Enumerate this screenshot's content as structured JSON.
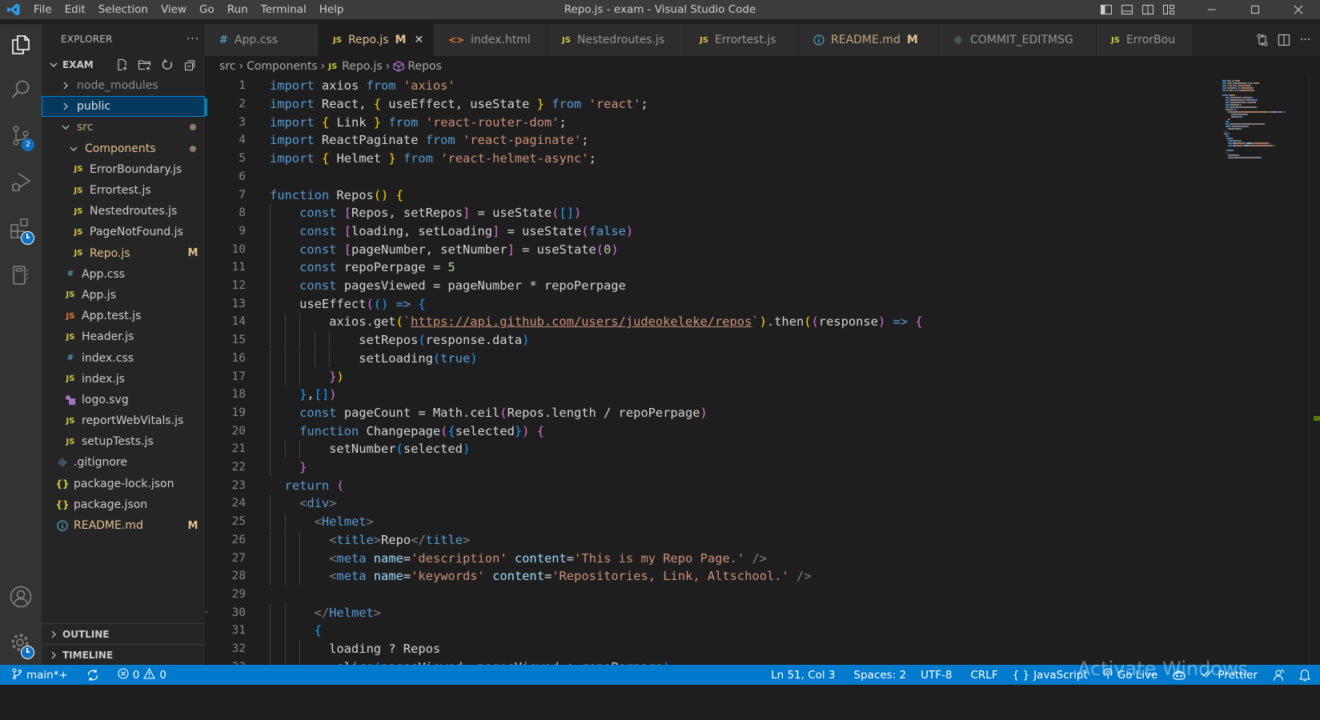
{
  "titlebar": {
    "window_title": "Repo.js - exam - Visual Studio Code",
    "menu": [
      "File",
      "Edit",
      "Selection",
      "View",
      "Go",
      "Run",
      "Terminal",
      "Help"
    ],
    "layout_controls": [
      "toggle-primary-sidebar",
      "toggle-panel",
      "toggle-secondary-sidebar",
      "customize-layout"
    ],
    "window_controls": [
      "minimize",
      "maximize",
      "close"
    ]
  },
  "activity_bar": {
    "items": [
      {
        "name": "explorer",
        "active": true
      },
      {
        "name": "search"
      },
      {
        "name": "source-control",
        "badge": "2"
      },
      {
        "name": "run-and-debug"
      },
      {
        "name": "extensions",
        "badge_icon": "clock"
      },
      {
        "name": "remote-explorer"
      }
    ],
    "bottom": [
      {
        "name": "accounts"
      },
      {
        "name": "manage",
        "badge_icon": "clock"
      }
    ]
  },
  "sidebar": {
    "title": "EXPLORER",
    "more": "···",
    "workspace": "EXAM",
    "tree": [
      {
        "label": "node_modules",
        "type": "folder",
        "expanded": false,
        "depth": 0,
        "dim": true
      },
      {
        "label": "public",
        "type": "folder",
        "expanded": false,
        "depth": 0,
        "selected": true
      },
      {
        "label": "src",
        "type": "folder",
        "expanded": true,
        "depth": 0,
        "modified_dot": true
      },
      {
        "label": "Components",
        "type": "folder",
        "expanded": true,
        "depth": 1,
        "modified_dot": true,
        "modified": true
      },
      {
        "label": "ErrorBoundary.js",
        "type": "js",
        "depth": 2
      },
      {
        "label": "Errortest.js",
        "type": "js",
        "depth": 2
      },
      {
        "label": "Nestedroutes.js",
        "type": "js",
        "depth": 2
      },
      {
        "label": "PageNotFound.js",
        "type": "js",
        "depth": 2
      },
      {
        "label": "Repo.js",
        "type": "js",
        "depth": 2,
        "status": "M"
      },
      {
        "label": "App.css",
        "type": "css",
        "depth": 1
      },
      {
        "label": "App.js",
        "type": "js",
        "depth": 1
      },
      {
        "label": "App.test.js",
        "type": "test",
        "depth": 1
      },
      {
        "label": "Header.js",
        "type": "js",
        "depth": 1
      },
      {
        "label": "index.css",
        "type": "css",
        "depth": 1
      },
      {
        "label": "index.js",
        "type": "js",
        "depth": 1
      },
      {
        "label": "logo.svg",
        "type": "svg",
        "depth": 1
      },
      {
        "label": "reportWebVitals.js",
        "type": "js",
        "depth": 1
      },
      {
        "label": "setupTests.js",
        "type": "js",
        "depth": 1
      },
      {
        "label": ".gitignore",
        "type": "git",
        "depth": 0
      },
      {
        "label": "package-lock.json",
        "type": "json",
        "depth": 0
      },
      {
        "label": "package.json",
        "type": "json",
        "depth": 0
      },
      {
        "label": "README.md",
        "type": "info",
        "depth": 0,
        "status": "M"
      }
    ],
    "outline_label": "OUTLINE",
    "timeline_label": "TIMELINE"
  },
  "tabs": [
    {
      "label": "App.css",
      "icon": "css"
    },
    {
      "label": "Repo.js",
      "icon": "js",
      "active": true,
      "status": "M"
    },
    {
      "label": "index.html",
      "icon": "html"
    },
    {
      "label": "Nestedroutes.js",
      "icon": "js"
    },
    {
      "label": "Errortest.js",
      "icon": "js"
    },
    {
      "label": "README.md",
      "icon": "info",
      "status": "M",
      "modified": true
    },
    {
      "label": "COMMIT_EDITMSG",
      "icon": "git"
    },
    {
      "label": "ErrorBou",
      "icon": "js"
    }
  ],
  "breadcrumb": [
    "src",
    "Components",
    "Repo.js",
    "Repos"
  ],
  "editor": {
    "lines": [
      [
        [
          "kw",
          "import"
        ],
        [
          "pl",
          " axios "
        ],
        [
          "kw",
          "from"
        ],
        [
          "pl",
          " "
        ],
        [
          "str",
          "'axios'"
        ]
      ],
      [
        [
          "kw",
          "import"
        ],
        [
          "pl",
          " React, "
        ],
        [
          "p1",
          "{"
        ],
        [
          "pl",
          " useEffect, useState "
        ],
        [
          "p1",
          "}"
        ],
        [
          "pl",
          " "
        ],
        [
          "kw",
          "from"
        ],
        [
          "pl",
          " "
        ],
        [
          "str",
          "'react'"
        ],
        [
          "pl",
          ";"
        ]
      ],
      [
        [
          "kw",
          "import"
        ],
        [
          "pl",
          " "
        ],
        [
          "p1",
          "{"
        ],
        [
          "pl",
          " Link "
        ],
        [
          "p1",
          "}"
        ],
        [
          "pl",
          " "
        ],
        [
          "kw",
          "from"
        ],
        [
          "pl",
          " "
        ],
        [
          "str",
          "'react-router-dom'"
        ],
        [
          "pl",
          ";"
        ]
      ],
      [
        [
          "kw",
          "import"
        ],
        [
          "pl",
          " ReactPaginate "
        ],
        [
          "kw",
          "from"
        ],
        [
          "pl",
          " "
        ],
        [
          "str",
          "'react-paginate'"
        ],
        [
          "pl",
          ";"
        ]
      ],
      [
        [
          "kw",
          "import"
        ],
        [
          "pl",
          " "
        ],
        [
          "p1",
          "{"
        ],
        [
          "pl",
          " Helmet "
        ],
        [
          "p1",
          "}"
        ],
        [
          "pl",
          " "
        ],
        [
          "kw",
          "from"
        ],
        [
          "pl",
          " "
        ],
        [
          "str",
          "'react-helmet-async'"
        ],
        [
          "pl",
          ";"
        ]
      ],
      [],
      [
        [
          "kw",
          "function"
        ],
        [
          "pl",
          " Repos"
        ],
        [
          "p1",
          "()"
        ],
        [
          "pl",
          " "
        ],
        [
          "p1",
          "{"
        ]
      ],
      [
        [
          "pl",
          "    "
        ],
        [
          "kw",
          "const"
        ],
        [
          "pl",
          " "
        ],
        [
          "p2",
          "["
        ],
        [
          "pl",
          "Repos, setRepos"
        ],
        [
          "p2",
          "]"
        ],
        [
          "pl",
          " = useState"
        ],
        [
          "p2",
          "("
        ],
        [
          "p3",
          "[]"
        ],
        [
          "p2",
          ")"
        ]
      ],
      [
        [
          "pl",
          "    "
        ],
        [
          "kw",
          "const"
        ],
        [
          "pl",
          " "
        ],
        [
          "p2",
          "["
        ],
        [
          "pl",
          "loading, setLoading"
        ],
        [
          "p2",
          "]"
        ],
        [
          "pl",
          " = useState"
        ],
        [
          "p2",
          "("
        ],
        [
          "kw",
          "false"
        ],
        [
          "p2",
          ")"
        ]
      ],
      [
        [
          "pl",
          "    "
        ],
        [
          "kw",
          "const"
        ],
        [
          "pl",
          " "
        ],
        [
          "p2",
          "["
        ],
        [
          "pl",
          "pageNumber, setNumber"
        ],
        [
          "p2",
          "]"
        ],
        [
          "pl",
          " = useState"
        ],
        [
          "p2",
          "("
        ],
        [
          "num",
          "0"
        ],
        [
          "p2",
          ")"
        ]
      ],
      [
        [
          "pl",
          "    "
        ],
        [
          "kw",
          "const"
        ],
        [
          "pl",
          " repoPerpage = "
        ],
        [
          "num",
          "5"
        ]
      ],
      [
        [
          "pl",
          "    "
        ],
        [
          "kw",
          "const"
        ],
        [
          "pl",
          " pagesViewed = pageNumber * repoPerpage"
        ]
      ],
      [
        [
          "pl",
          "    useEffect"
        ],
        [
          "p2",
          "("
        ],
        [
          "p3",
          "()"
        ],
        [
          "pl",
          " "
        ],
        [
          "kw",
          "=>"
        ],
        [
          "pl",
          " "
        ],
        [
          "p3",
          "{"
        ]
      ],
      [
        [
          "pl",
          "        axios.get"
        ],
        [
          "p1",
          "("
        ],
        [
          "str",
          "`"
        ],
        [
          "url",
          "https://api.github.com/users/judeokeleke/repos"
        ],
        [
          "str",
          "`"
        ],
        [
          "p1",
          ")"
        ],
        [
          "pl",
          ".then"
        ],
        [
          "p1",
          "("
        ],
        [
          "p2",
          "("
        ],
        [
          "pl",
          "response"
        ],
        [
          "p2",
          ")"
        ],
        [
          "pl",
          " "
        ],
        [
          "kw",
          "=>"
        ],
        [
          "pl",
          " "
        ],
        [
          "p2",
          "{"
        ]
      ],
      [
        [
          "pl",
          "            setRepos"
        ],
        [
          "p3",
          "("
        ],
        [
          "pl",
          "response.data"
        ],
        [
          "p3",
          ")"
        ]
      ],
      [
        [
          "pl",
          "            setLoading"
        ],
        [
          "p3",
          "("
        ],
        [
          "kw",
          "true"
        ],
        [
          "p3",
          ")"
        ]
      ],
      [
        [
          "pl",
          "        "
        ],
        [
          "p2",
          "}"
        ],
        [
          "p1",
          ")"
        ]
      ],
      [
        [
          "pl",
          "    "
        ],
        [
          "p3",
          "}"
        ],
        [
          "pl",
          ","
        ],
        [
          "p3",
          "[]"
        ],
        [
          "p2",
          ")"
        ]
      ],
      [
        [
          "pl",
          "    "
        ],
        [
          "kw",
          "const"
        ],
        [
          "pl",
          " pageCount = Math.ceil"
        ],
        [
          "p2",
          "("
        ],
        [
          "pl",
          "Repos.length / repoPerpage"
        ],
        [
          "p2",
          ")"
        ]
      ],
      [
        [
          "pl",
          "    "
        ],
        [
          "kw",
          "function"
        ],
        [
          "pl",
          " Changepage"
        ],
        [
          "p2",
          "("
        ],
        [
          "p3",
          "{"
        ],
        [
          "pl",
          "selected"
        ],
        [
          "p3",
          "}"
        ],
        [
          "p2",
          ")"
        ],
        [
          "pl",
          " "
        ],
        [
          "p2",
          "{"
        ]
      ],
      [
        [
          "pl",
          "        setNumber"
        ],
        [
          "p3",
          "("
        ],
        [
          "pl",
          "selected"
        ],
        [
          "p3",
          ")"
        ]
      ],
      [
        [
          "pl",
          "    "
        ],
        [
          "p2",
          "}"
        ]
      ],
      [
        [
          "pl",
          "  "
        ],
        [
          "kw",
          "return"
        ],
        [
          "pl",
          " "
        ],
        [
          "p2",
          "("
        ]
      ],
      [
        [
          "pl",
          "    "
        ],
        [
          "brk",
          "<"
        ],
        [
          "tag",
          "div"
        ],
        [
          "brk",
          ">"
        ]
      ],
      [
        [
          "pl",
          "      "
        ],
        [
          "brk",
          "<"
        ],
        [
          "tag",
          "Helmet"
        ],
        [
          "brk",
          ">"
        ]
      ],
      [
        [
          "pl",
          "        "
        ],
        [
          "brk",
          "<"
        ],
        [
          "tag",
          "title"
        ],
        [
          "brk",
          ">"
        ],
        [
          "pl",
          "Repo"
        ],
        [
          "brk",
          "</"
        ],
        [
          "tag",
          "title"
        ],
        [
          "brk",
          ">"
        ]
      ],
      [
        [
          "pl",
          "        "
        ],
        [
          "brk",
          "<"
        ],
        [
          "tag",
          "meta"
        ],
        [
          "pl",
          " "
        ],
        [
          "attr",
          "name"
        ],
        [
          "pl",
          "="
        ],
        [
          "str",
          "'description'"
        ],
        [
          "pl",
          " "
        ],
        [
          "attr",
          "content"
        ],
        [
          "pl",
          "="
        ],
        [
          "str",
          "'This is my Repo Page.'"
        ],
        [
          "pl",
          " "
        ],
        [
          "brk",
          "/>"
        ]
      ],
      [
        [
          "pl",
          "        "
        ],
        [
          "brk",
          "<"
        ],
        [
          "tag",
          "meta"
        ],
        [
          "pl",
          " "
        ],
        [
          "attr",
          "name"
        ],
        [
          "pl",
          "="
        ],
        [
          "str",
          "'keywords'"
        ],
        [
          "pl",
          " "
        ],
        [
          "attr",
          "content"
        ],
        [
          "pl",
          "="
        ],
        [
          "str",
          "'Repositories, Link, Altschool.'"
        ],
        [
          "pl",
          " "
        ],
        [
          "brk",
          "/>"
        ]
      ],
      [],
      [
        [
          "pl",
          "      "
        ],
        [
          "brk",
          "</"
        ],
        [
          "tag",
          "Helmet"
        ],
        [
          "brk",
          ">"
        ]
      ],
      [
        [
          "pl",
          "      "
        ],
        [
          "p3",
          "{"
        ]
      ],
      [
        [
          "pl",
          "        loading ? Repos"
        ]
      ],
      [
        [
          "pl",
          "        .slice"
        ],
        [
          "p3",
          "("
        ],
        [
          "pl",
          "pagesViewed, pagesViewed + repoPerpage"
        ],
        [
          "p3",
          ")"
        ]
      ]
    ]
  },
  "statusbar": {
    "branch": "main*+",
    "errors": "0",
    "warnings": "0",
    "cursor": "Ln 51, Col 3",
    "spaces": "Spaces: 2",
    "encoding": "UTF-8",
    "eol": "CRLF",
    "language": "JavaScript",
    "golive": "Go Live",
    "prettier": "Prettier"
  },
  "watermark": "Activate Windows",
  "colors": {
    "accent": "#007acc",
    "modified": "#e2c08d",
    "js_icon": "#cbcb41",
    "badge": "#0e70c0"
  }
}
